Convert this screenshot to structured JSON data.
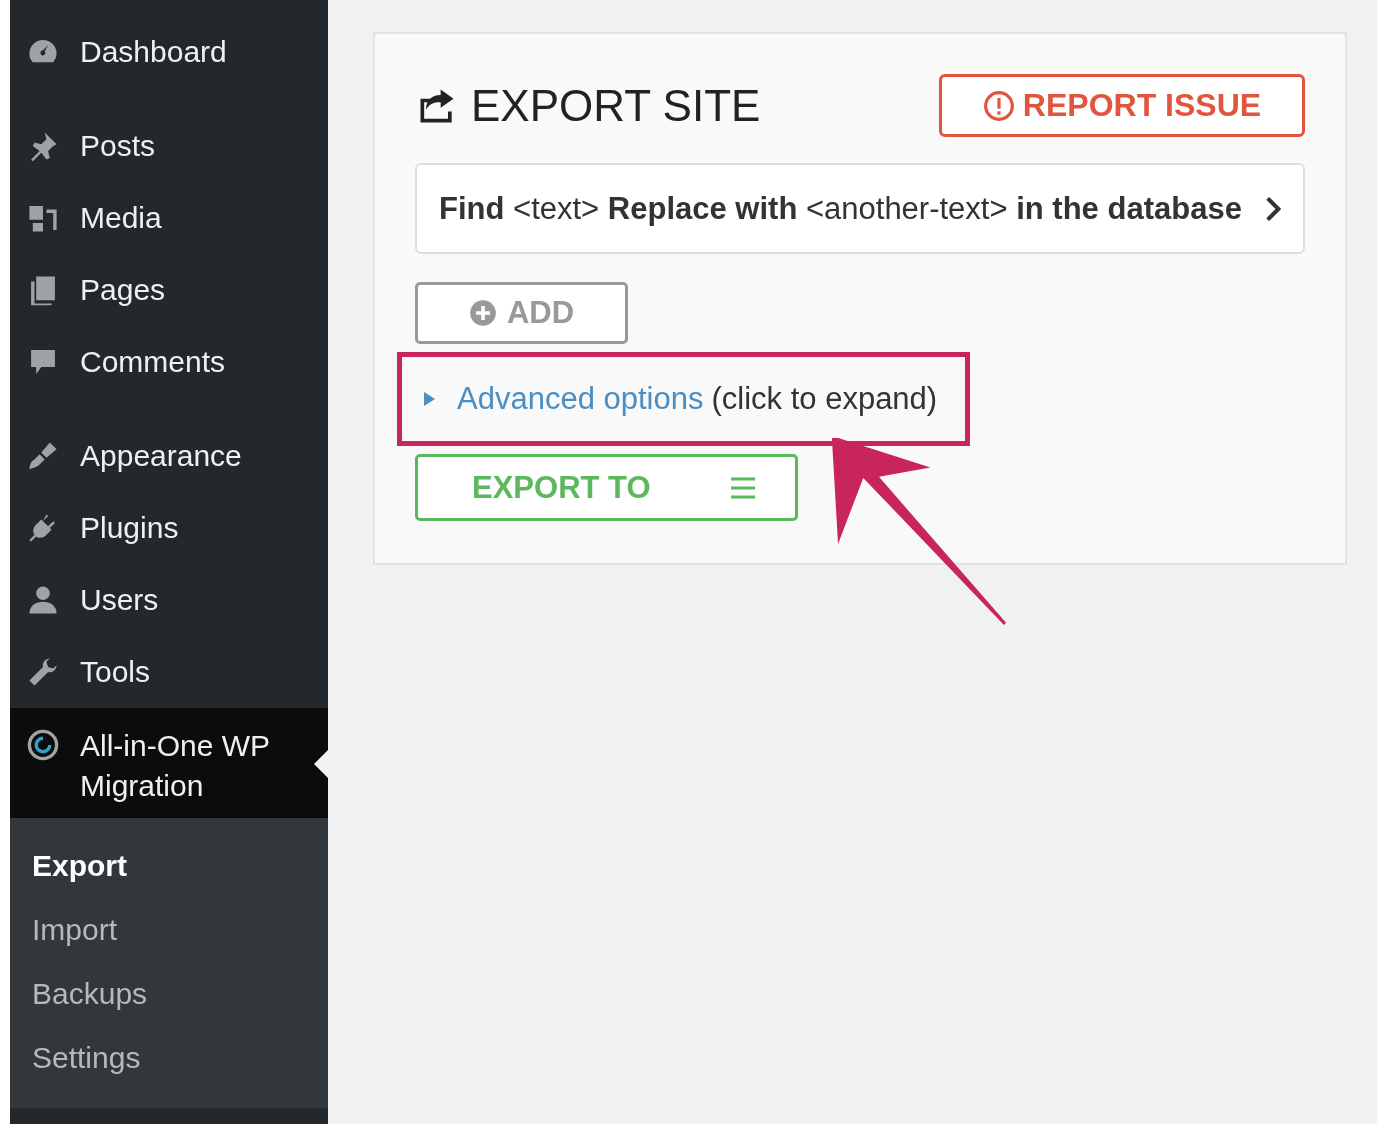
{
  "sidebar": {
    "groups": [
      [
        {
          "label": "Dashboard",
          "kind": "gauge",
          "selected": false
        }
      ],
      [
        {
          "label": "Posts",
          "kind": "pin",
          "selected": false
        },
        {
          "label": "Media",
          "kind": "media",
          "selected": false
        },
        {
          "label": "Pages",
          "kind": "pages",
          "selected": false
        },
        {
          "label": "Comments",
          "kind": "comment",
          "selected": false
        }
      ],
      [
        {
          "label": "Appearance",
          "kind": "brush",
          "selected": false
        },
        {
          "label": "Plugins",
          "kind": "plug",
          "selected": false
        },
        {
          "label": "Users",
          "kind": "user",
          "selected": false
        },
        {
          "label": "Tools",
          "kind": "wrench",
          "selected": false
        },
        {
          "label": "All-in-One WP Migration",
          "kind": "migration",
          "selected": true
        }
      ]
    ],
    "submenu": [
      {
        "label": "Export",
        "selected": true
      },
      {
        "label": "Import",
        "selected": false
      },
      {
        "label": "Backups",
        "selected": false
      },
      {
        "label": "Settings",
        "selected": false
      }
    ]
  },
  "panel": {
    "title": "EXPORT SITE",
    "report_button": "REPORT ISSUE",
    "find_replace": "**Find** <text> **Replace with** <another-text> **in the database**",
    "add_button": "ADD",
    "advanced": {
      "link": "Advanced options",
      "hint": "(click to expand)",
      "expanded": false,
      "highlighted": true
    },
    "export_button": "EXPORT TO"
  }
}
